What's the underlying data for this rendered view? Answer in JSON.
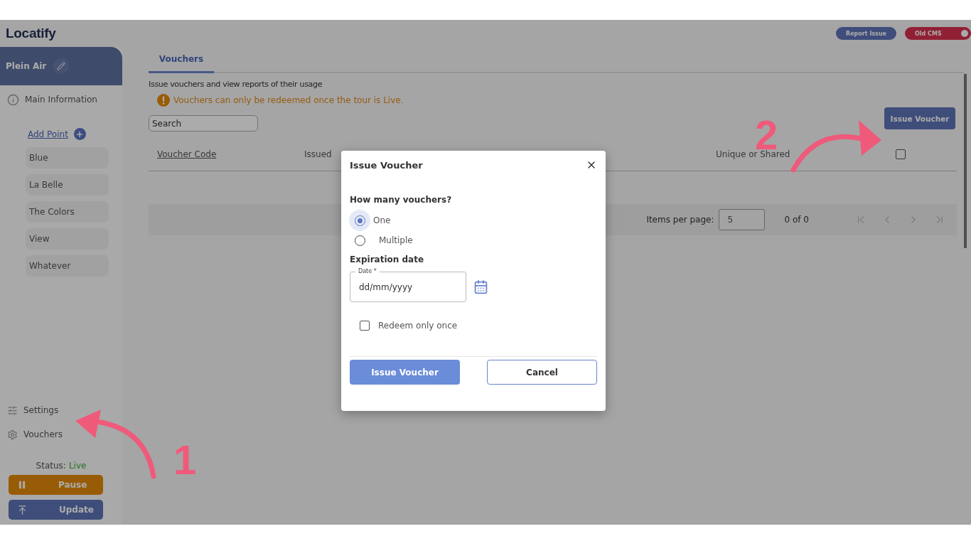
{
  "logo": "Locatify",
  "top_buttons": {
    "report": "Report Issue",
    "old_cms": {
      "label": "Old CMS",
      "on": true
    }
  },
  "sidebar": {
    "tour_name": "Plein Air",
    "main_info": "Main Information",
    "add_point": "Add Point",
    "points": [
      "Blue",
      "La Belle",
      "The Colors",
      "View",
      "Whatever"
    ],
    "bottom_items": [
      {
        "label": "Settings",
        "kind": "settings"
      },
      {
        "label": "Vouchers",
        "kind": "vouchers"
      }
    ],
    "status_label": "Status:",
    "status_value": "Live",
    "pause": "Pause",
    "update": "Update"
  },
  "tabs": [
    {
      "label": "Vouchers",
      "selected": true
    }
  ],
  "description": "Issue vouchers and view reports of their usage",
  "warning": "Vouchers can only be redeemed once the tour is Live.",
  "search": {
    "placeholder": "Search"
  },
  "issue_button": "Issue Voucher",
  "table": {
    "columns": [
      "Voucher Code",
      "Issued",
      "Unique or Shared"
    ],
    "select_all_checked": false
  },
  "pagination": {
    "label": "Items per page:",
    "per_page": "5",
    "range": "0 of 0"
  },
  "dialog": {
    "title": "Issue Voucher",
    "question": "How many vouchers?",
    "options": [
      {
        "label": "One",
        "selected": true
      },
      {
        "label": "Multiple",
        "selected": false
      }
    ],
    "expiration_label": "Expiration date",
    "date_field": {
      "label": "Date *",
      "placeholder": "dd/mm/yyyy"
    },
    "redeem_once": {
      "label": "Redeem only once",
      "checked": false
    },
    "primary": "Issue Voucher",
    "secondary": "Cancel"
  },
  "annotations": [
    {
      "number": "1"
    },
    {
      "number": "2"
    }
  ]
}
